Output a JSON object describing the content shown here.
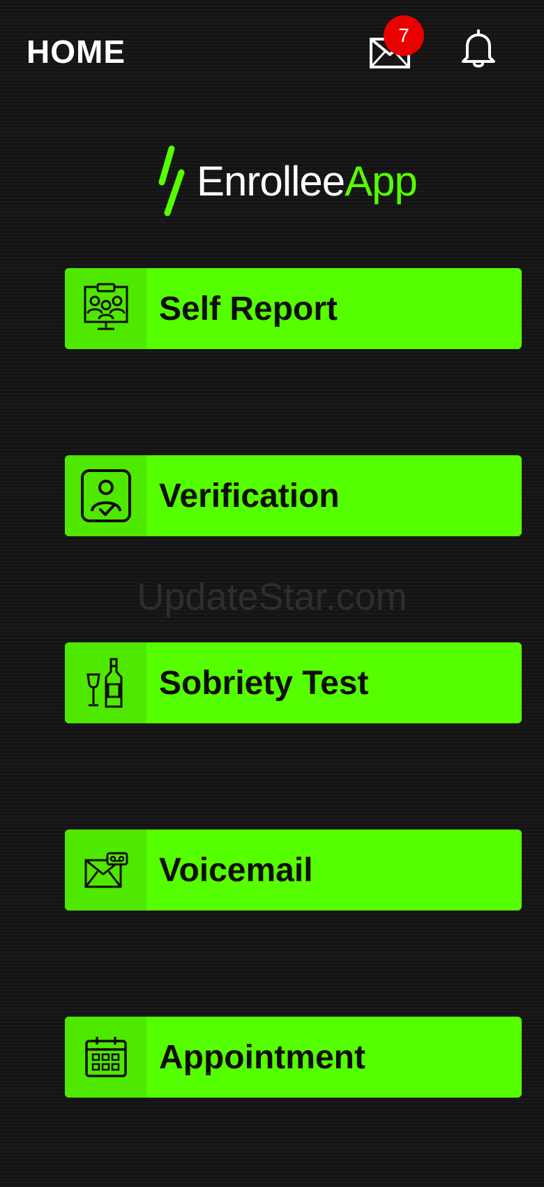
{
  "header": {
    "title": "HOME",
    "mail_badge_count": "7"
  },
  "logo": {
    "text_white": "Enrollee",
    "text_green": "App"
  },
  "watermark": "UpdateStar.com",
  "menu": [
    {
      "label": "Self Report",
      "icon": "video-conference-icon"
    },
    {
      "label": "Verification",
      "icon": "user-verified-icon"
    },
    {
      "label": "Sobriety Test",
      "icon": "wine-bottle-icon"
    },
    {
      "label": "Voicemail",
      "icon": "voicemail-envelope-icon"
    },
    {
      "label": "Appointment",
      "icon": "calendar-icon"
    }
  ],
  "colors": {
    "background": "#141414",
    "accent": "#55ff00",
    "badge": "#ea0000",
    "text": "#ffffff"
  }
}
